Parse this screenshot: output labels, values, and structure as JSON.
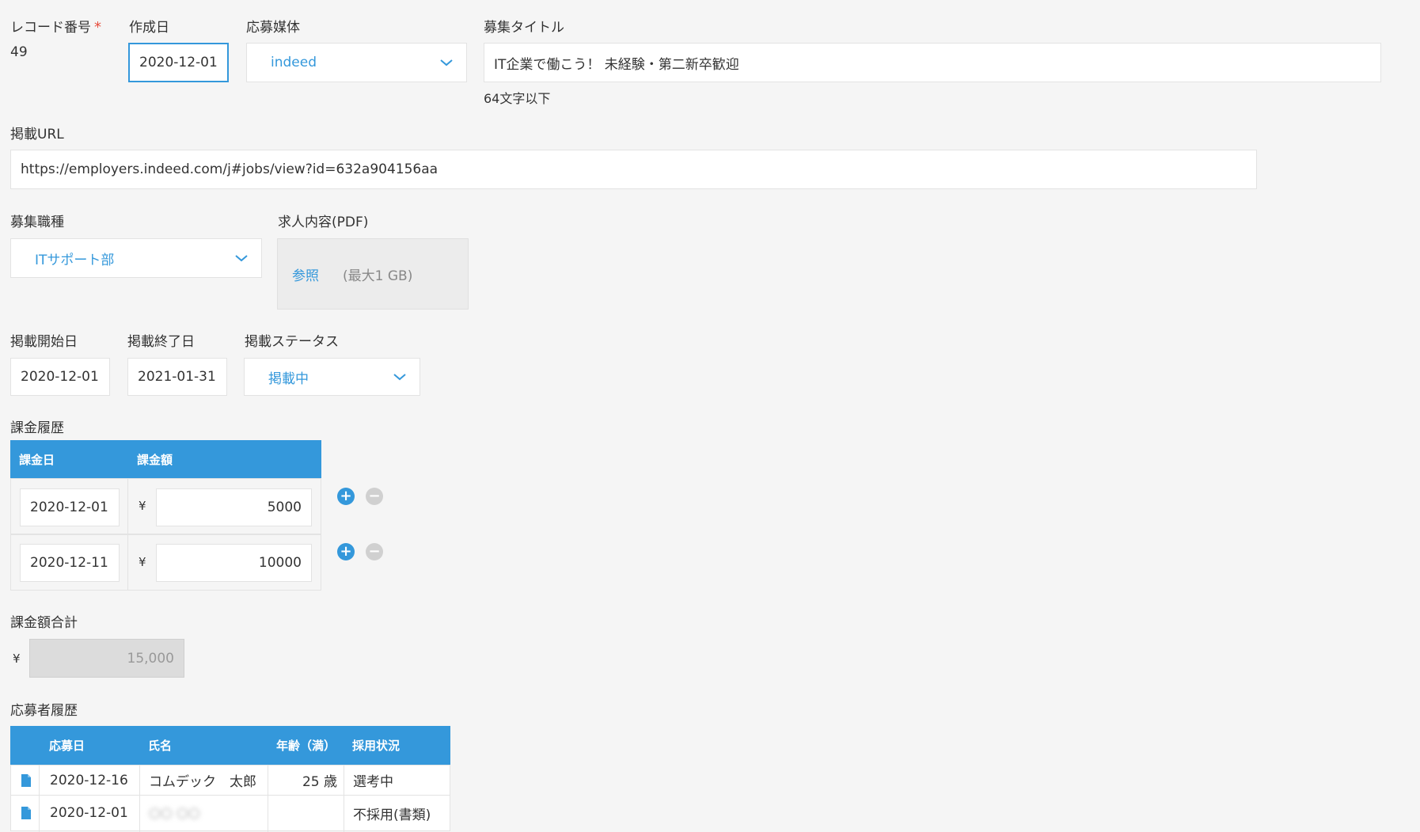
{
  "record_number": {
    "label": "レコード番号",
    "required_mark": "*",
    "value": "49"
  },
  "created_date": {
    "label": "作成日",
    "value": "2020-12-01"
  },
  "media": {
    "label": "応募媒体",
    "value": "indeed"
  },
  "job_title": {
    "label": "募集タイトル",
    "value": "IT企業で働こう！ 未経験・第二新卒歓迎",
    "hint": "64文字以下"
  },
  "url": {
    "label": "掲載URL",
    "value": "https://employers.indeed.com/j#jobs/view?id=632a904156aa"
  },
  "job_type": {
    "label": "募集職種",
    "value": "ITサポート部"
  },
  "pdf": {
    "label": "求人内容(PDF)",
    "browse": "参照",
    "note": "(最大1 GB)"
  },
  "start_date": {
    "label": "掲載開始日",
    "value": "2020-12-01"
  },
  "end_date": {
    "label": "掲載終了日",
    "value": "2021-01-31"
  },
  "status": {
    "label": "掲載ステータス",
    "value": "掲載中"
  },
  "billing": {
    "label": "課金履歴",
    "headers": [
      "課金日",
      "課金額"
    ],
    "currency": "¥",
    "rows": [
      {
        "date": "2020-12-01",
        "amount": "5000"
      },
      {
        "date": "2020-12-11",
        "amount": "10000"
      }
    ],
    "add_symbol": "+",
    "remove_symbol": "−"
  },
  "billing_total": {
    "label": "課金額合計",
    "currency": "¥",
    "value": "15,000"
  },
  "applicants": {
    "label": "応募者履歴",
    "headers": [
      "応募日",
      "氏名",
      "年齢（満）",
      "採用状況"
    ],
    "rows": [
      {
        "date": "2020-12-16",
        "name": "コムデック　太郎",
        "age": "25 歳",
        "status": "選考中"
      },
      {
        "date": "2020-12-01",
        "name": "○○ ○○",
        "age": "",
        "status": "不採用(書類)"
      }
    ]
  },
  "colors": {
    "accent": "#3498db",
    "required": "#e74c3c",
    "background": "#f5f5f5"
  },
  "icons": {
    "dropdown": "chevron-down-icon",
    "record_link": "document-icon"
  }
}
